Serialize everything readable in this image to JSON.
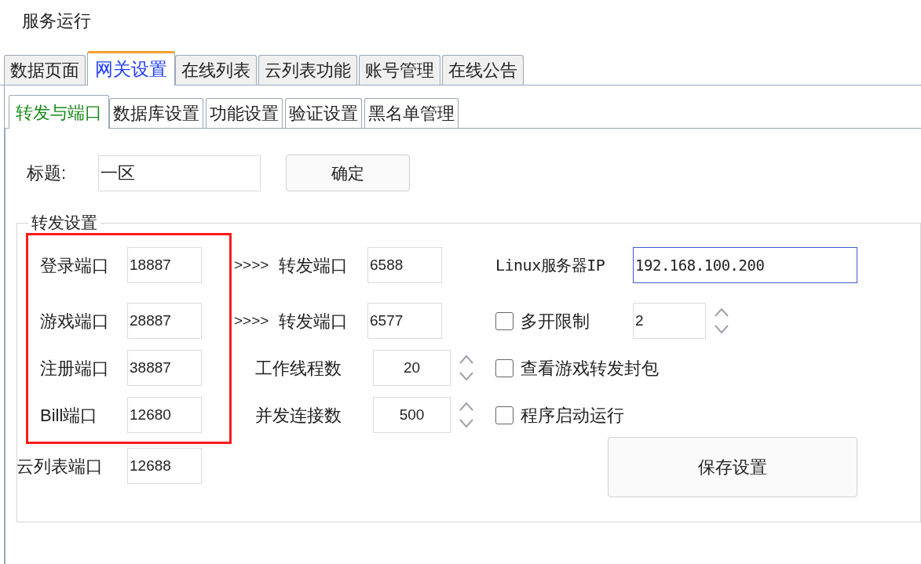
{
  "app_title": "服务运行",
  "main_tabs": [
    {
      "label": "数据页面",
      "selected": false
    },
    {
      "label": "网关设置",
      "selected": true
    },
    {
      "label": "在线列表",
      "selected": false
    },
    {
      "label": "云列表功能",
      "selected": false
    },
    {
      "label": "账号管理",
      "selected": false
    },
    {
      "label": "在线公告",
      "selected": false
    }
  ],
  "sub_tabs": [
    {
      "label": "转发与端口",
      "selected": true
    },
    {
      "label": "数据库设置",
      "selected": false
    },
    {
      "label": "功能设置",
      "selected": false
    },
    {
      "label": "验证设置",
      "selected": false
    },
    {
      "label": "黑名单管理",
      "selected": false
    }
  ],
  "title_field": {
    "label": "标题:",
    "value": "一区"
  },
  "confirm_button": "确定",
  "group": {
    "title": "转发设置",
    "ports": [
      {
        "label": "登录端口",
        "value": "18887",
        "highlighted": true
      },
      {
        "label": "游戏端口",
        "value": "28887",
        "highlighted": true
      },
      {
        "label": "注册端口",
        "value": "38887",
        "highlighted": true
      },
      {
        "label": "Bill端口",
        "value": "12680",
        "highlighted": true
      },
      {
        "label": "云列表端口",
        "value": "12688",
        "highlighted": false
      }
    ],
    "middle": [
      {
        "kind": "forward",
        "arrow": ">>>>",
        "label": "转发端口",
        "value": "6588"
      },
      {
        "kind": "forward",
        "arrow": ">>>>",
        "label": "转发端口",
        "value": "6577"
      },
      {
        "kind": "spin",
        "label": "工作线程数",
        "value": "20"
      },
      {
        "kind": "spin",
        "label": "并发连接数",
        "value": "500"
      }
    ],
    "right": [
      {
        "kind": "ip",
        "label": "Linux服务器IP",
        "value": "192.168.100.200",
        "focused": true
      },
      {
        "kind": "checkbox_spin",
        "label": "多开限制",
        "checked": false,
        "value": "2"
      },
      {
        "kind": "checkbox",
        "label": "查看游戏转发封包",
        "checked": false
      },
      {
        "kind": "checkbox",
        "label": "程序启动运行",
        "checked": false
      },
      {
        "kind": "button",
        "label": "保存设置"
      }
    ]
  }
}
